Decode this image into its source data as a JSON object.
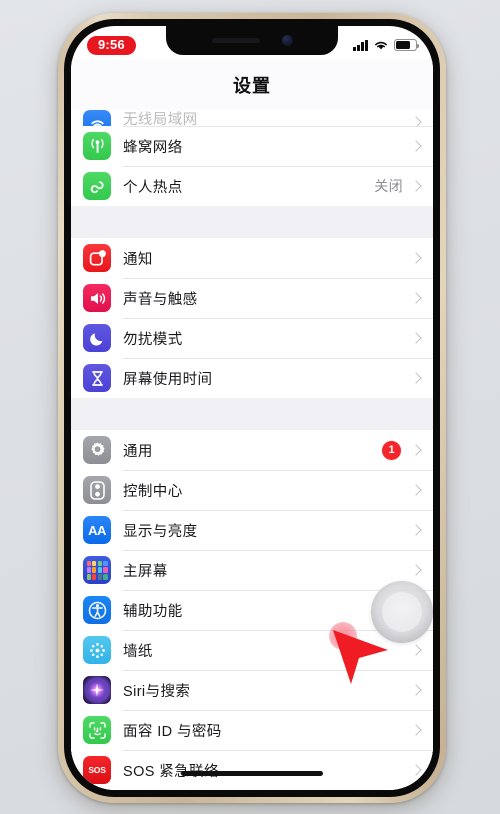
{
  "status_bar": {
    "time": "9:56",
    "time_is_recording": true,
    "signal_icon": "cellular-signal-icon",
    "wifi_icon": "wifi-icon",
    "battery_icon": "battery-icon"
  },
  "nav": {
    "title": "设置"
  },
  "groups": [
    {
      "id": "connectivity",
      "rows": [
        {
          "icon": "wifi-icon",
          "icon_class": "ic-wifi",
          "label": "无线局域网",
          "value": "",
          "badge": "",
          "clipped": true
        },
        {
          "icon": "cellular-icon",
          "icon_class": "ic-cell",
          "label": "蜂窝网络",
          "value": "",
          "badge": "",
          "clipped": false
        },
        {
          "icon": "hotspot-icon",
          "icon_class": "ic-hot",
          "label": "个人热点",
          "value": "关闭",
          "badge": "",
          "clipped": false
        }
      ]
    },
    {
      "id": "alerts",
      "rows": [
        {
          "icon": "notifications-icon",
          "icon_class": "ic-notif",
          "label": "通知",
          "value": "",
          "badge": "",
          "clipped": false
        },
        {
          "icon": "sounds-haptics-icon",
          "icon_class": "ic-sound",
          "label": "声音与触感",
          "value": "",
          "badge": "",
          "clipped": false
        },
        {
          "icon": "do-not-disturb-icon",
          "icon_class": "ic-dnd",
          "label": "勿扰模式",
          "value": "",
          "badge": "",
          "clipped": false
        },
        {
          "icon": "screen-time-icon",
          "icon_class": "ic-screen",
          "label": "屏幕使用时间",
          "value": "",
          "badge": "",
          "clipped": false
        }
      ]
    },
    {
      "id": "system",
      "rows": [
        {
          "icon": "gear-icon",
          "icon_class": "ic-gen",
          "label": "通用",
          "value": "",
          "badge": "1",
          "clipped": false
        },
        {
          "icon": "control-center-icon",
          "icon_class": "ic-ctrl",
          "label": "控制中心",
          "value": "",
          "badge": "",
          "clipped": false
        },
        {
          "icon": "display-brightness-icon",
          "icon_class": "ic-disp",
          "label": "显示与亮度",
          "value": "",
          "badge": "",
          "clipped": false
        },
        {
          "icon": "home-screen-icon",
          "icon_class": "ic-home",
          "label": "主屏幕",
          "value": "",
          "badge": "",
          "clipped": false
        },
        {
          "icon": "accessibility-icon",
          "icon_class": "ic-acc",
          "label": "辅助功能",
          "value": "",
          "badge": "",
          "clipped": false
        },
        {
          "icon": "wallpaper-icon",
          "icon_class": "ic-wall",
          "label": "墙纸",
          "value": "",
          "badge": "",
          "clipped": false
        },
        {
          "icon": "siri-icon",
          "icon_class": "ic-siri",
          "label": "Siri与搜索",
          "value": "",
          "badge": "",
          "clipped": false
        },
        {
          "icon": "face-id-icon",
          "icon_class": "ic-face",
          "label": "面容 ID 与密码",
          "value": "",
          "badge": "",
          "clipped": false
        },
        {
          "icon": "sos-icon",
          "icon_class": "ic-sos",
          "label": "SOS 紧急联络",
          "value": "",
          "badge": "",
          "clipped": false
        }
      ]
    }
  ],
  "overlays": {
    "assistive_touch": "assistive-touch-button",
    "cursor": "red-pointer-cursor",
    "tap_indicator": "tap-highlight-circle"
  },
  "colors": {
    "accent_red": "#f5262b",
    "recording_red": "#e8171f",
    "list_bg": "#f0f0f5",
    "row_bg": "#ffffff",
    "separator": "#e6e6ea",
    "frame_gold": "#d9c9ab",
    "page_bg": "#dcdfe4"
  }
}
